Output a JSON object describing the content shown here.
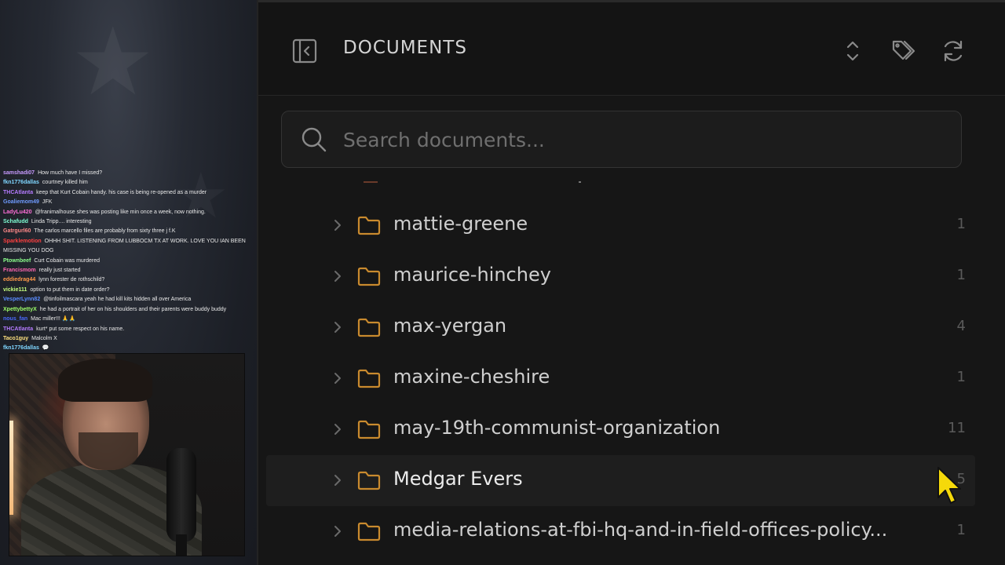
{
  "chat": [
    {
      "user": "samshadi07",
      "color": "#c89bff",
      "text": "How much have I missed?"
    },
    {
      "user": "fkn1776dallas",
      "color": "#7fd6ff",
      "text": "courtney killed him"
    },
    {
      "user": "THCAtlanta",
      "color": "#b57bff",
      "text": "keep that Kurt Cobain handy. his case is being re-opened as a murder"
    },
    {
      "user": "Goaliemom49",
      "color": "#6f9bff",
      "text": "JFK"
    },
    {
      "user": "LadyLu420",
      "color": "#ff6fd8",
      "text": "@franimalhouse shes was posting like min once a week, now nothing."
    },
    {
      "user": "Schafudd",
      "color": "#7fffd4",
      "text": "Linda Tripp.... interesting"
    },
    {
      "user": "Gatrgurl60",
      "color": "#ff8a8a",
      "text": "The carlos marcello files are probably from sixty three j f.K"
    },
    {
      "user": "Sparklemotion",
      "color": "#ff4040",
      "text": "OHHH SHIT. LISTENING FROM LUBBOCM TX AT WORK. LOVE YOU IAN BEEN MISSING YOU DOG"
    },
    {
      "user": "Ptownbeef",
      "color": "#8cff8c",
      "text": "Curt Cobain was murdered"
    },
    {
      "user": "Francismom",
      "color": "#ff66b3",
      "text": "really just started"
    },
    {
      "user": "eddiedrag44",
      "color": "#ff9a4a",
      "text": "lynn forester de rothschild?"
    },
    {
      "user": "vickie111",
      "color": "#c6ff7f",
      "text": "option to put them in date order?"
    },
    {
      "user": "VesperLynn82",
      "color": "#5a8cff",
      "text": "@tinfoilmascara yeah he had kill kits hidden all over America"
    },
    {
      "user": "XpettybettyX",
      "color": "#9dff6a",
      "text": "he had a portrait of her on his shoulders and their parents were buddy buddy"
    },
    {
      "user": "nous_fan",
      "color": "#4a6aff",
      "text": "Mac miller!!! 🙏🙏"
    },
    {
      "user": "THCAtlanta",
      "color": "#b57bff",
      "text": "kurt* put some respect on his name."
    },
    {
      "user": "Taco1guy",
      "color": "#ffe27f",
      "text": "Malcolm X"
    },
    {
      "user": "fkn1776dallas",
      "color": "#7fd6ff",
      "text": "💬"
    }
  ],
  "header": {
    "title": "DOCUMENTS",
    "collapse_icon": "sidebar-collapse-icon",
    "sort_icon": "sort-updown-icon",
    "tag_icon": "tags-icon",
    "refresh_icon": "refresh-icon"
  },
  "search": {
    "placeholder": "Search documents...",
    "value": ""
  },
  "folders": [
    {
      "name": "mattie-greene",
      "count": "1",
      "highlighted": false
    },
    {
      "name": "maurice-hinchey",
      "count": "1",
      "highlighted": false
    },
    {
      "name": "max-yergan",
      "count": "4",
      "highlighted": false
    },
    {
      "name": "maxine-cheshire",
      "count": "1",
      "highlighted": false
    },
    {
      "name": "may-19th-communist-organization",
      "count": "11",
      "highlighted": false
    },
    {
      "name": "Medgar Evers",
      "count": "5",
      "highlighted": true
    },
    {
      "name": "media-relations-at-fbi-hq-and-in-field-offices-policy...",
      "count": "1",
      "highlighted": false
    }
  ],
  "colors": {
    "folder": "#c98a2e",
    "cursor": "#f5d90a",
    "panel_bg": "#161616"
  }
}
